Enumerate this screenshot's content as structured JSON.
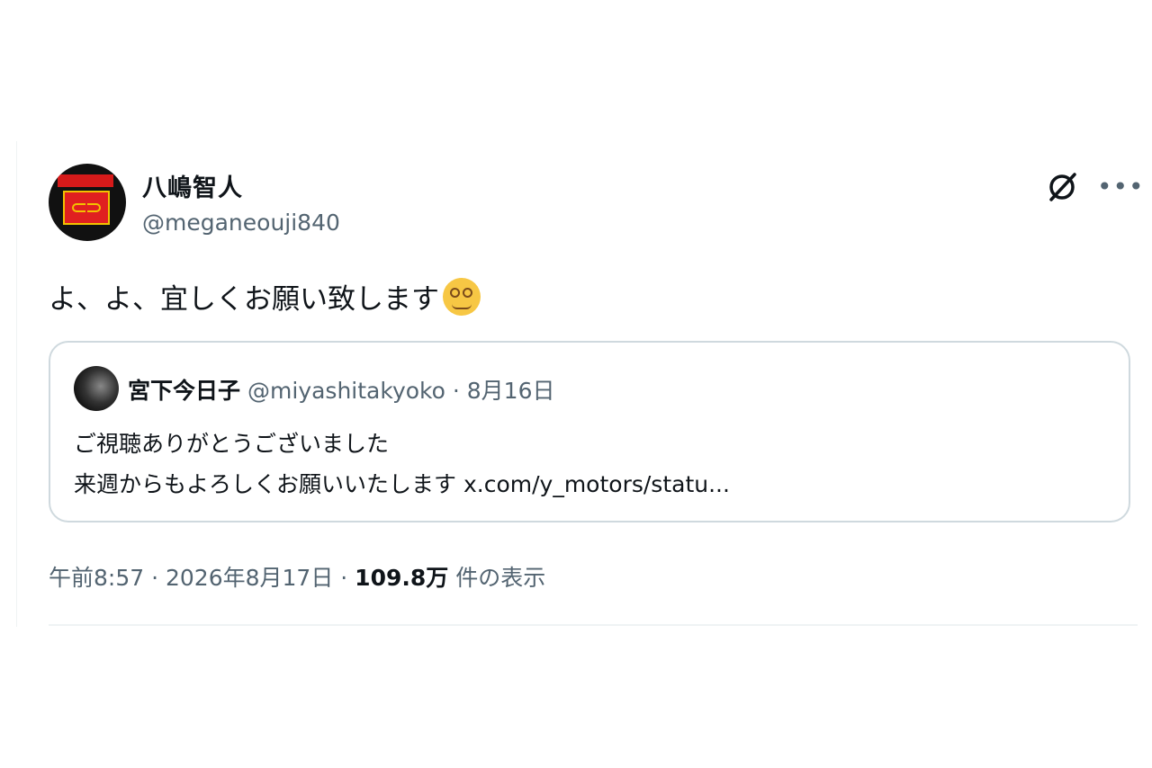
{
  "author": {
    "name": "八嶋智人",
    "handle": "@meganeouji840"
  },
  "icons": {
    "grok": "slashed-circle-icon",
    "more": "more-horizontal-icon"
  },
  "tweet": {
    "text": "よ、よ、宜しくお願い致します",
    "emoji": "woozy-face-emoji"
  },
  "quote": {
    "name": "宮下今日子",
    "meta": "@miyashitakyoko · 8月16日",
    "line1": "ご視聴ありがとうございました",
    "line2": "来週からもよろしくお願いいたします",
    "link": "x.com/y_motors/statu..."
  },
  "footer": {
    "time": "午前8:57 · 2026年8月17日 · ",
    "views_count": "109.8万",
    "views_label": " 件の表示"
  }
}
